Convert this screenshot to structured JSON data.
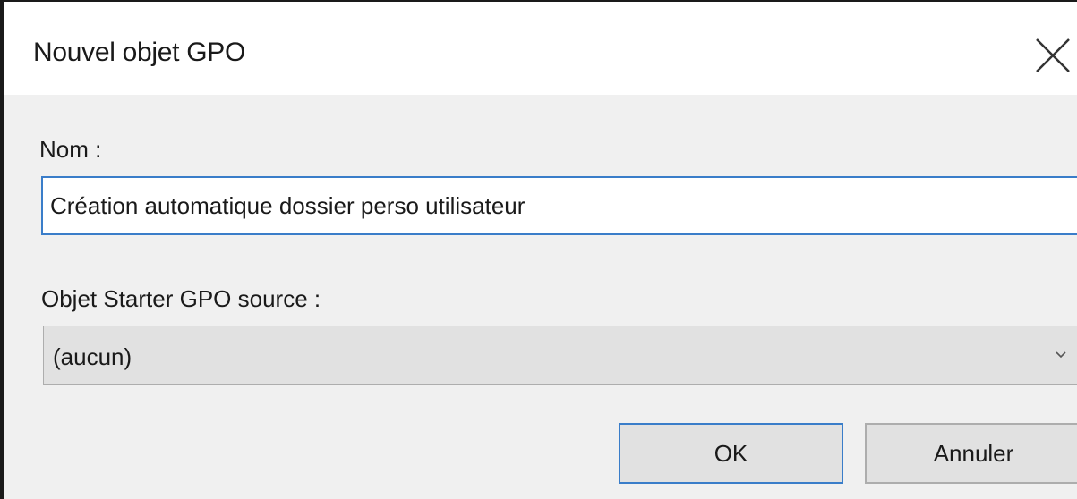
{
  "dialog": {
    "title": "Nouvel objet GPO",
    "close_icon": "close-icon"
  },
  "name": {
    "label": "Nom :",
    "value": "Création automatique dossier perso utilisateur"
  },
  "source": {
    "label": "Objet Starter GPO source :",
    "selected": "(aucun)",
    "dropdown_icon": "chevron-down-icon"
  },
  "buttons": {
    "ok": "OK",
    "cancel": "Annuler"
  },
  "colors": {
    "focus_border": "#3a7dc9",
    "dialog_background": "#f0f0f0",
    "control_background": "#e1e1e1"
  }
}
